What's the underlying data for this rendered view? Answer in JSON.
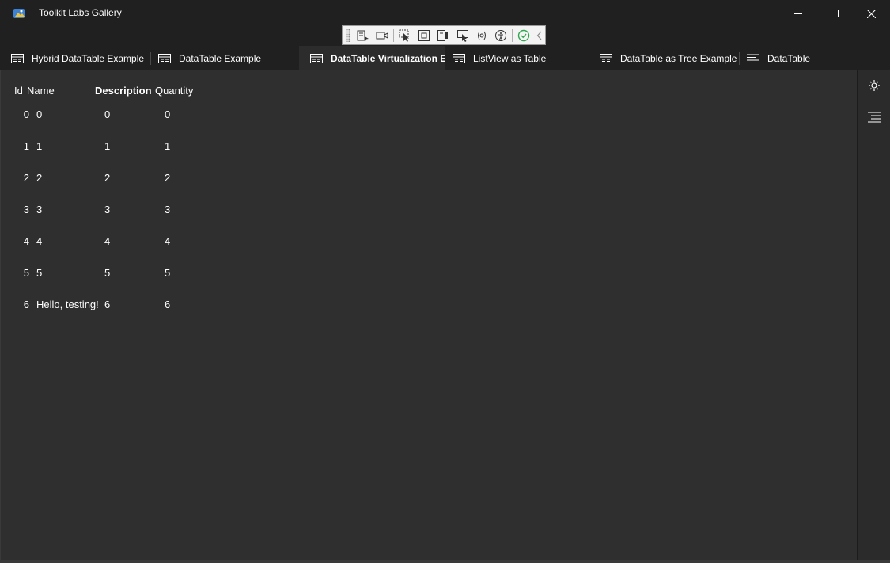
{
  "window": {
    "title": "Toolkit Labs Gallery",
    "icons": {
      "app": "app-logo-icon",
      "minimize": "minimize-icon",
      "maximize": "maximize-icon",
      "close": "close-icon"
    }
  },
  "debug_toolbar": {
    "buttons": [
      "go-to-live-visual-tree-icon",
      "video-icon",
      "select-element-icon",
      "display-layout-adorners-icon",
      "track-focus-icon",
      "preview-selection-icon",
      "binding-failures-icon",
      "accessibility-icon",
      "hot-reload-ok-icon",
      "collapse-chevron-icon"
    ]
  },
  "tabs": [
    {
      "label": "Hybrid DataTable Example",
      "icon": "table-icon"
    },
    {
      "label": "DataTable Example",
      "icon": "table-icon"
    },
    {
      "label": "DataTable Virtualization Ex",
      "icon": "table-icon",
      "selected": true
    },
    {
      "label": "ListView as Table",
      "icon": "table-icon"
    },
    {
      "label": "DataTable as Tree Example",
      "icon": "table-icon"
    },
    {
      "label": "DataTable",
      "icon": "text-lines-icon"
    }
  ],
  "table": {
    "headers": {
      "id": "Id",
      "name": "Name",
      "description": "Description",
      "quantity": "Quantity"
    },
    "rows": [
      {
        "id": "0",
        "name": "0",
        "description": "0",
        "quantity": "0"
      },
      {
        "id": "1",
        "name": "1",
        "description": "1",
        "quantity": "1"
      },
      {
        "id": "2",
        "name": "2",
        "description": "2",
        "quantity": "2"
      },
      {
        "id": "3",
        "name": "3",
        "description": "3",
        "quantity": "3"
      },
      {
        "id": "4",
        "name": "4",
        "description": "4",
        "quantity": "4"
      },
      {
        "id": "5",
        "name": "5",
        "description": "5",
        "quantity": "5"
      },
      {
        "id": "6",
        "name": "Hello, testing!",
        "description": "6",
        "quantity": "6"
      }
    ]
  },
  "side_panel": {
    "buttons": [
      "theme-toggle-icon",
      "toc-icon"
    ]
  },
  "colors": {
    "background": "#202020",
    "content": "#2f2f2f",
    "text": "#ffffff",
    "selected_tab": "#2c2c2c",
    "accent_check": "#2fa84f"
  }
}
